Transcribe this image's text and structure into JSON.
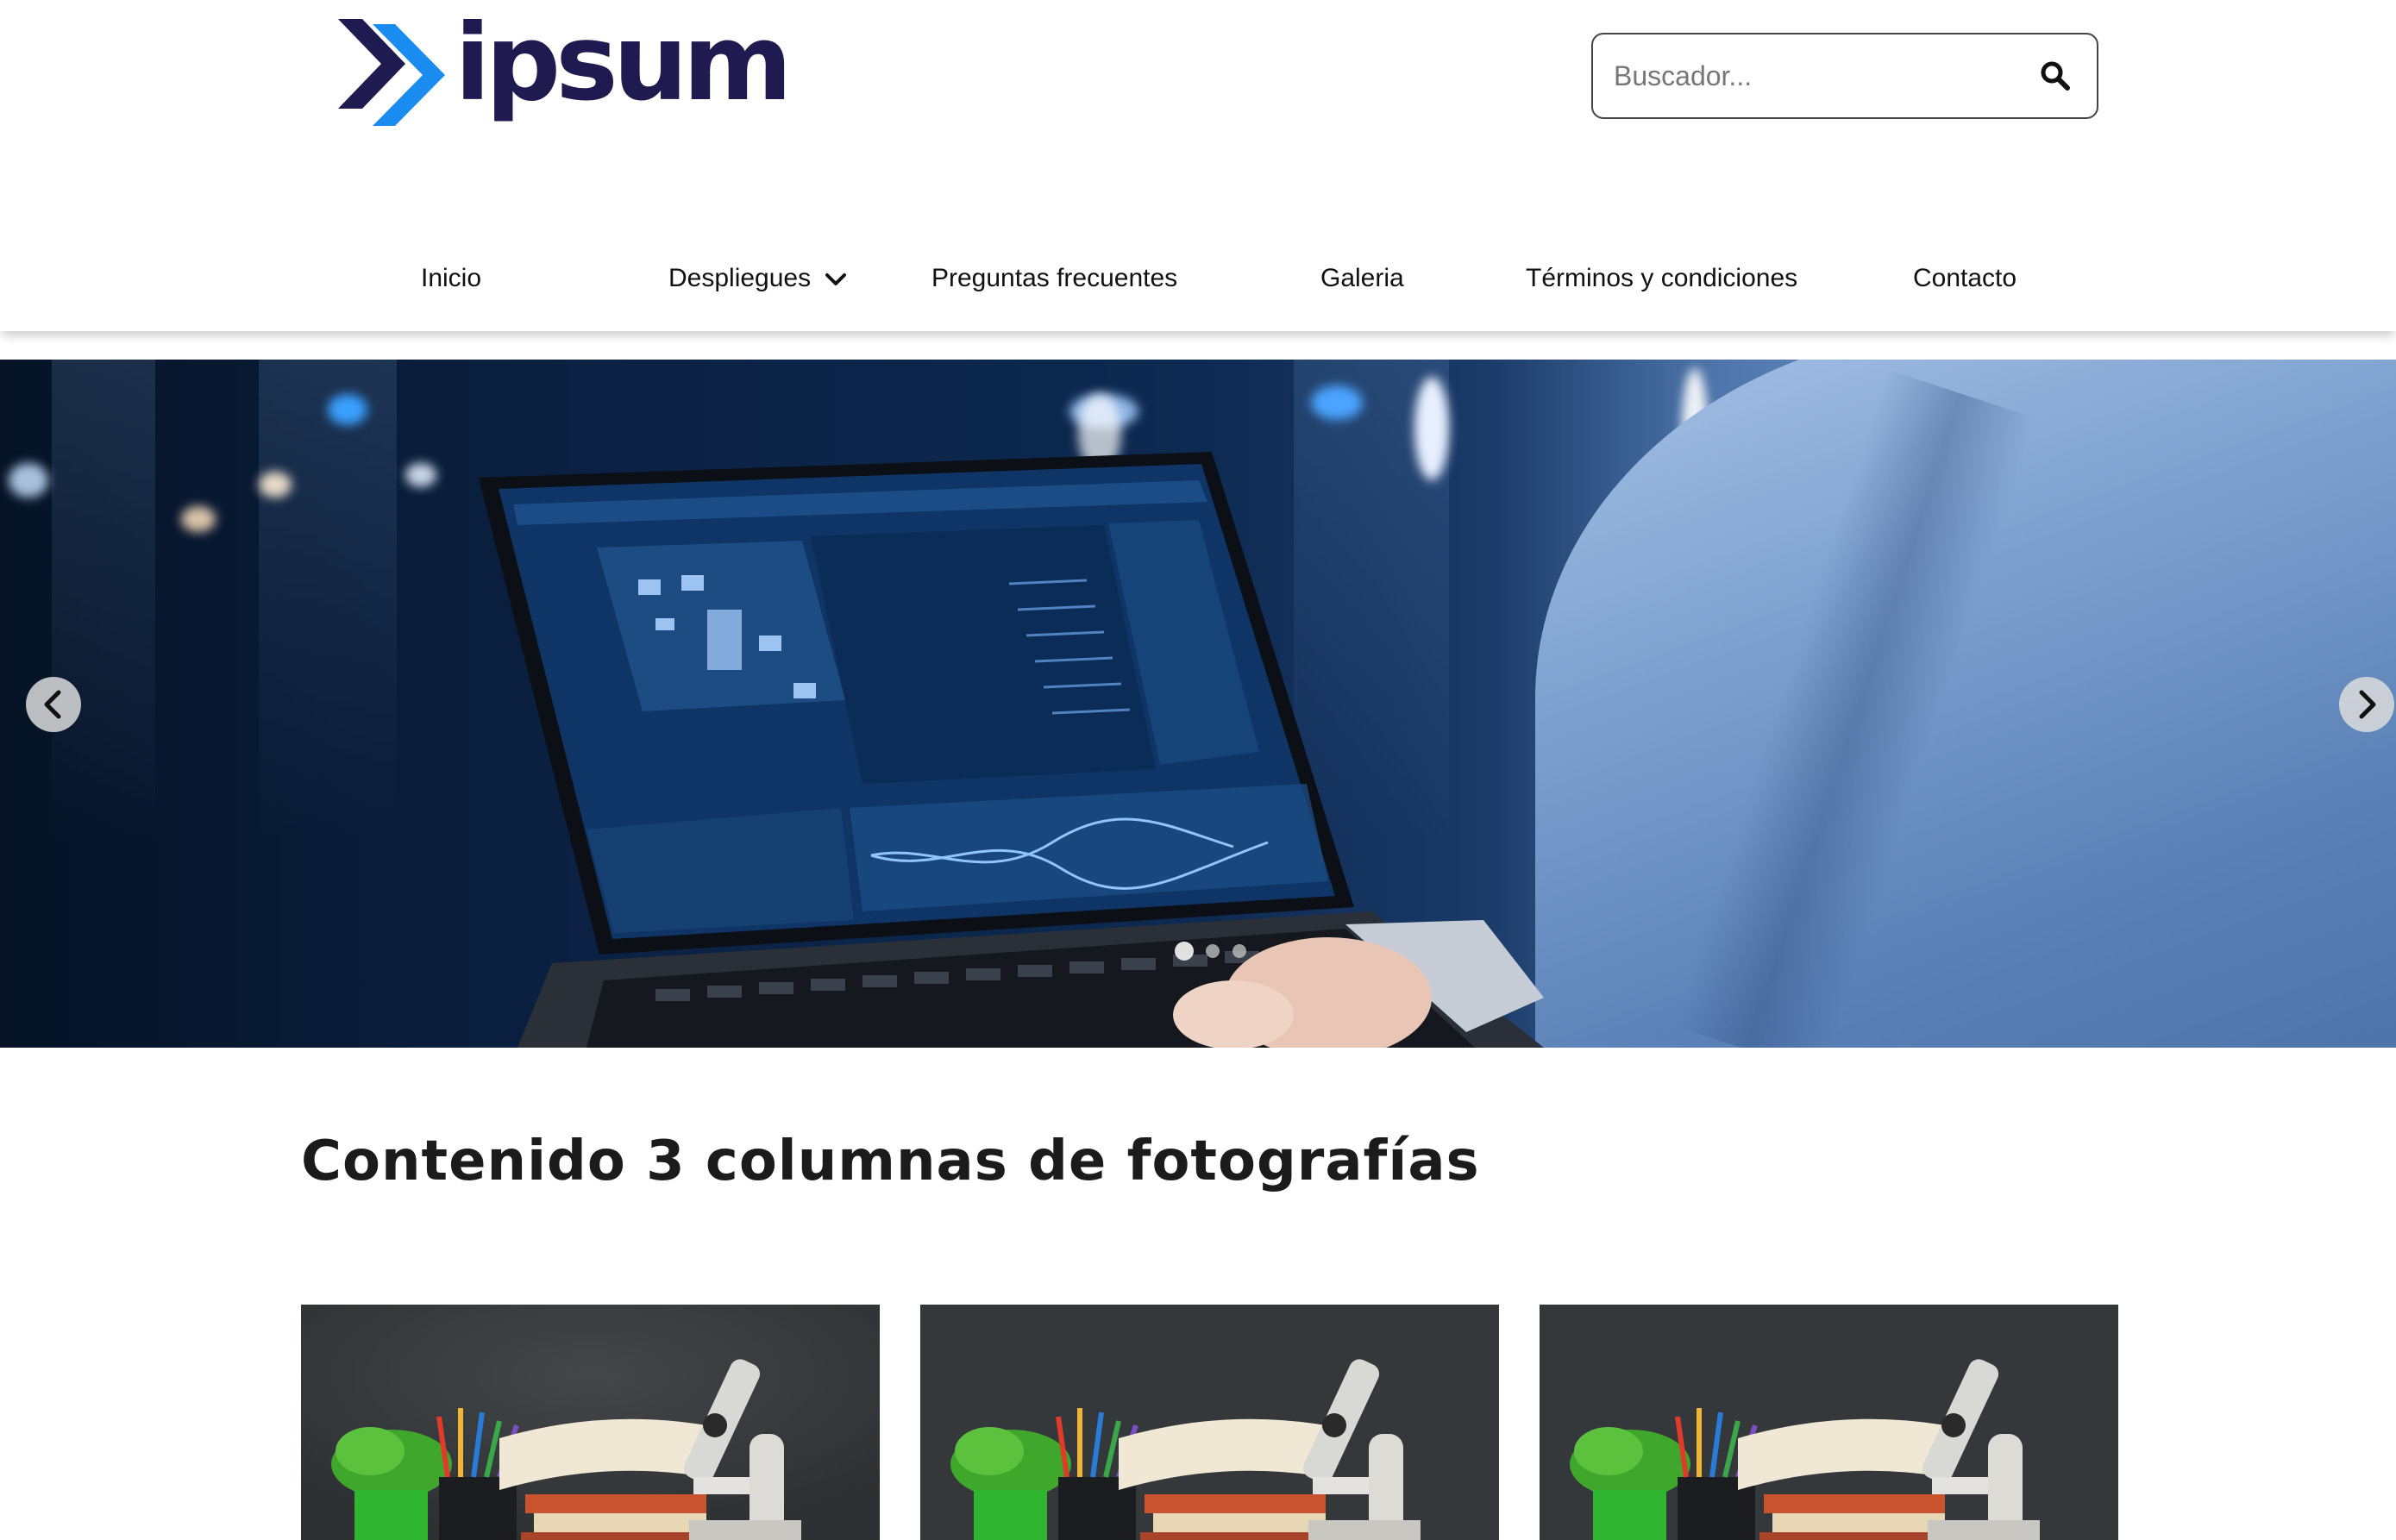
{
  "header": {
    "logo_text": "ipsum",
    "brand_colors": {
      "dark": "#1f1a4f",
      "blue": "#1a8cf0"
    },
    "search": {
      "placeholder": "Buscador...",
      "value": "",
      "icon": "search-icon"
    }
  },
  "nav": {
    "items": [
      {
        "label": "Inicio"
      },
      {
        "label": "Despliegues",
        "icon": "chevron-down-icon"
      },
      {
        "label": "Preguntas frecuentes"
      },
      {
        "label": "Galeria"
      },
      {
        "label": "Términos y condiciones"
      },
      {
        "label": "Contacto"
      }
    ]
  },
  "carousel": {
    "image": "person typing on laptop in server room",
    "prev_icon": "chevron-left-icon",
    "next_icon": "chevron-right-icon",
    "slide_count": 3,
    "active_slide": 1
  },
  "main": {
    "section_title": "Contenido 3 columnas de fotografías",
    "cards": [
      {
        "image": "books, plant, pencils and microscope on chalkboard background"
      },
      {
        "image": "books, plant, pencils and microscope on chalkboard background"
      },
      {
        "image": "books, plant, pencils and microscope on chalkboard background"
      }
    ]
  }
}
